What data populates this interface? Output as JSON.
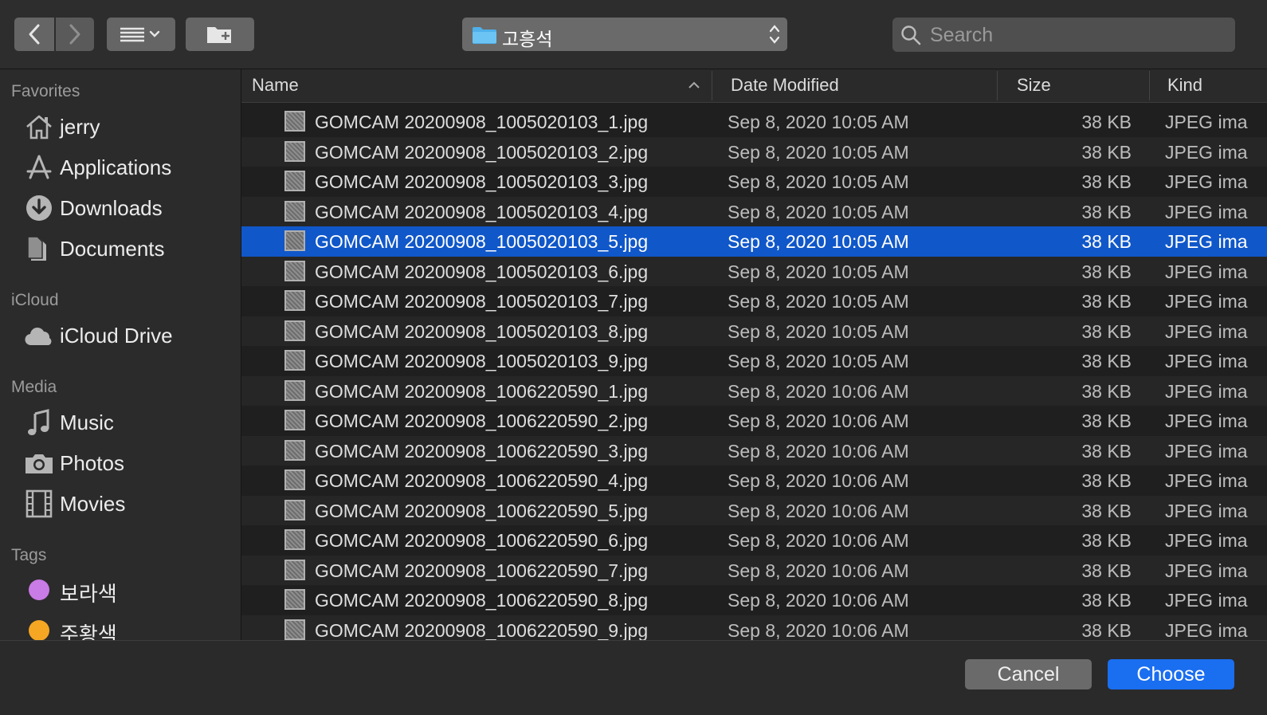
{
  "toolbar": {
    "back_icon": "chevron-left-icon",
    "forward_icon": "chevron-right-icon",
    "view_icon": "list-view-icon",
    "new_folder_icon": "new-folder-icon",
    "path_label": "고흥석",
    "search_placeholder": "Search"
  },
  "sidebar": {
    "favorites_title": "Favorites",
    "favorites": [
      {
        "label": "jerry",
        "icon": "home-icon"
      },
      {
        "label": "Applications",
        "icon": "applications-icon"
      },
      {
        "label": "Downloads",
        "icon": "downloads-icon"
      },
      {
        "label": "Documents",
        "icon": "documents-icon"
      }
    ],
    "icloud_title": "iCloud",
    "icloud": [
      {
        "label": "iCloud Drive",
        "icon": "cloud-icon"
      }
    ],
    "media_title": "Media",
    "media": [
      {
        "label": "Music",
        "icon": "music-icon"
      },
      {
        "label": "Photos",
        "icon": "camera-icon"
      },
      {
        "label": "Movies",
        "icon": "film-icon"
      }
    ],
    "tags_title": "Tags",
    "tags": [
      {
        "label": "보라색",
        "color": "#c97be6"
      },
      {
        "label": "주황색",
        "color": "#f5a623"
      }
    ]
  },
  "columns": {
    "name": "Name",
    "date": "Date Modified",
    "size": "Size",
    "kind": "Kind"
  },
  "files": [
    {
      "name": "GOMCAM 20200908_1005020103_1.jpg",
      "date": "Sep 8, 2020 10:05 AM",
      "size": "38 KB",
      "kind": "JPEG ima"
    },
    {
      "name": "GOMCAM 20200908_1005020103_2.jpg",
      "date": "Sep 8, 2020 10:05 AM",
      "size": "38 KB",
      "kind": "JPEG ima"
    },
    {
      "name": "GOMCAM 20200908_1005020103_3.jpg",
      "date": "Sep 8, 2020 10:05 AM",
      "size": "38 KB",
      "kind": "JPEG ima"
    },
    {
      "name": "GOMCAM 20200908_1005020103_4.jpg",
      "date": "Sep 8, 2020 10:05 AM",
      "size": "38 KB",
      "kind": "JPEG ima"
    },
    {
      "name": "GOMCAM 20200908_1005020103_5.jpg",
      "date": "Sep 8, 2020 10:05 AM",
      "size": "38 KB",
      "kind": "JPEG ima",
      "selected": true
    },
    {
      "name": "GOMCAM 20200908_1005020103_6.jpg",
      "date": "Sep 8, 2020 10:05 AM",
      "size": "38 KB",
      "kind": "JPEG ima"
    },
    {
      "name": "GOMCAM 20200908_1005020103_7.jpg",
      "date": "Sep 8, 2020 10:05 AM",
      "size": "38 KB",
      "kind": "JPEG ima"
    },
    {
      "name": "GOMCAM 20200908_1005020103_8.jpg",
      "date": "Sep 8, 2020 10:05 AM",
      "size": "38 KB",
      "kind": "JPEG ima"
    },
    {
      "name": "GOMCAM 20200908_1005020103_9.jpg",
      "date": "Sep 8, 2020 10:05 AM",
      "size": "38 KB",
      "kind": "JPEG ima"
    },
    {
      "name": "GOMCAM 20200908_1006220590_1.jpg",
      "date": "Sep 8, 2020 10:06 AM",
      "size": "38 KB",
      "kind": "JPEG ima"
    },
    {
      "name": "GOMCAM 20200908_1006220590_2.jpg",
      "date": "Sep 8, 2020 10:06 AM",
      "size": "38 KB",
      "kind": "JPEG ima"
    },
    {
      "name": "GOMCAM 20200908_1006220590_3.jpg",
      "date": "Sep 8, 2020 10:06 AM",
      "size": "38 KB",
      "kind": "JPEG ima"
    },
    {
      "name": "GOMCAM 20200908_1006220590_4.jpg",
      "date": "Sep 8, 2020 10:06 AM",
      "size": "38 KB",
      "kind": "JPEG ima"
    },
    {
      "name": "GOMCAM 20200908_1006220590_5.jpg",
      "date": "Sep 8, 2020 10:06 AM",
      "size": "38 KB",
      "kind": "JPEG ima"
    },
    {
      "name": "GOMCAM 20200908_1006220590_6.jpg",
      "date": "Sep 8, 2020 10:06 AM",
      "size": "38 KB",
      "kind": "JPEG ima"
    },
    {
      "name": "GOMCAM 20200908_1006220590_7.jpg",
      "date": "Sep 8, 2020 10:06 AM",
      "size": "38 KB",
      "kind": "JPEG ima"
    },
    {
      "name": "GOMCAM 20200908_1006220590_8.jpg",
      "date": "Sep 8, 2020 10:06 AM",
      "size": "38 KB",
      "kind": "JPEG ima"
    },
    {
      "name": "GOMCAM 20200908_1006220590_9.jpg",
      "date": "Sep 8, 2020 10:06 AM",
      "size": "38 KB",
      "kind": "JPEG ima"
    }
  ],
  "buttons": {
    "cancel": "Cancel",
    "choose": "Choose"
  },
  "colors": {
    "selection": "#1057c9",
    "accent": "#1a6ef0"
  }
}
